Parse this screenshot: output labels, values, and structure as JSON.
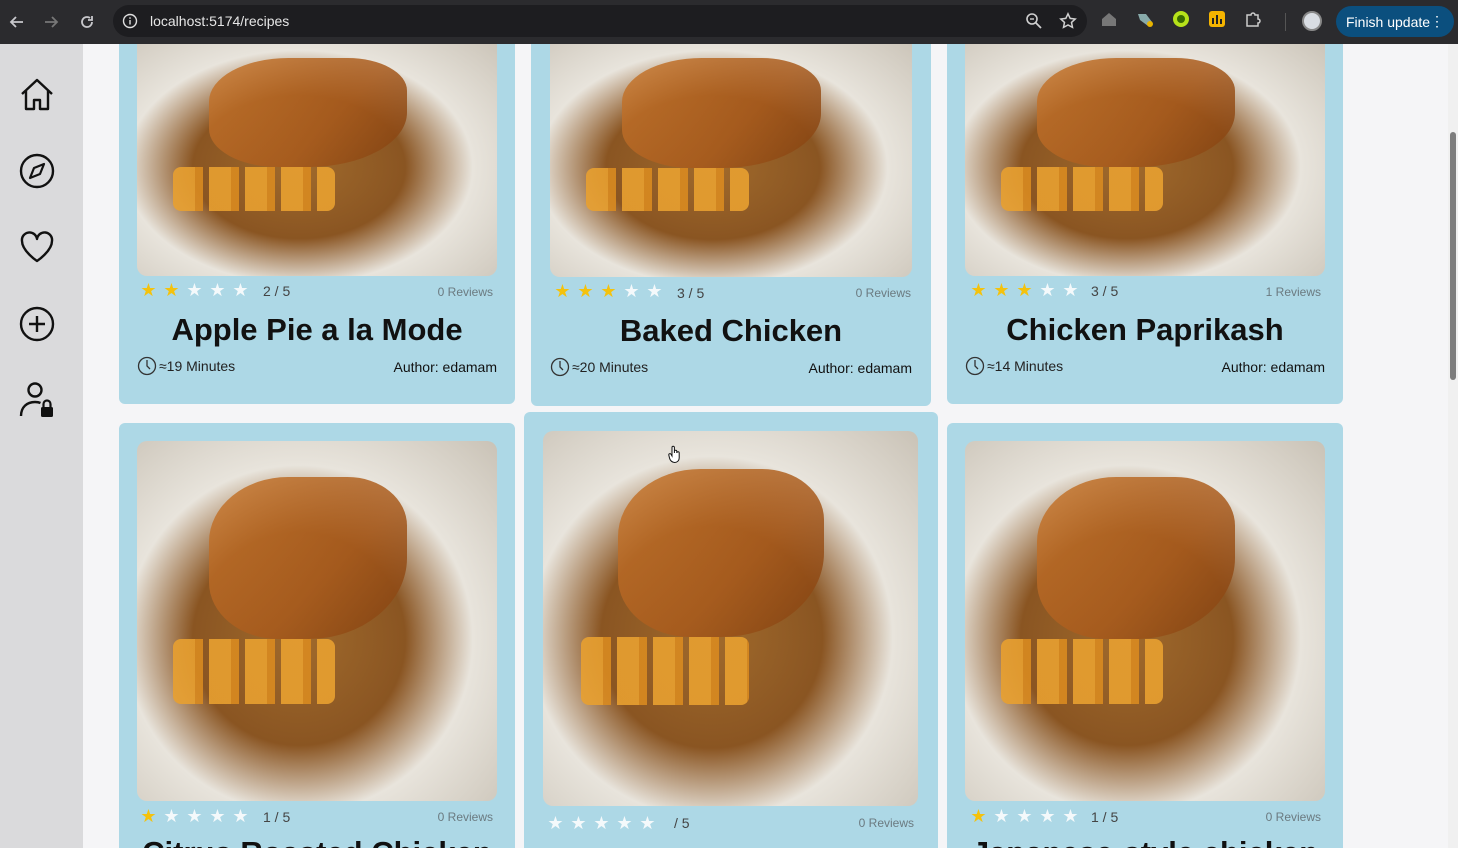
{
  "browser": {
    "url": "localhost:5174/recipes",
    "finish_update_label": "Finish update"
  },
  "sidebar": {
    "items": [
      {
        "name": "home-icon"
      },
      {
        "name": "compass-icon"
      },
      {
        "name": "heart-icon"
      },
      {
        "name": "plus-circle-icon"
      },
      {
        "name": "user-lock-icon"
      }
    ]
  },
  "recipes": [
    {
      "title": "Apple Pie a la Mode",
      "rating": 2,
      "rating_text": "2 / 5",
      "reviews": "0 Reviews",
      "time": "≈19 Minutes",
      "author": "Author: edamam"
    },
    {
      "title": "Baked Chicken",
      "rating": 3,
      "rating_text": "3 / 5",
      "reviews": "0 Reviews",
      "time": "≈20 Minutes",
      "author": "Author: edamam"
    },
    {
      "title": "Chicken Paprikash",
      "rating": 3,
      "rating_text": "3 / 5",
      "reviews": "1 Reviews",
      "time": "≈14 Minutes",
      "author": "Author: edamam"
    },
    {
      "title": "Citrus Roasted Chicken",
      "rating": 1,
      "rating_text": "1 / 5",
      "reviews": "0 Reviews"
    },
    {
      "title": "",
      "rating": 0,
      "rating_text": "/ 5",
      "reviews": "0 Reviews"
    },
    {
      "title": "Japanese-style chicken",
      "rating": 1,
      "rating_text": "1 / 5",
      "reviews": "0 Reviews"
    }
  ],
  "colors": {
    "card": "#add8e6",
    "star_on": "#f4c20d",
    "star_off": "#f4f9fb",
    "sidebar": "#dadadc"
  }
}
